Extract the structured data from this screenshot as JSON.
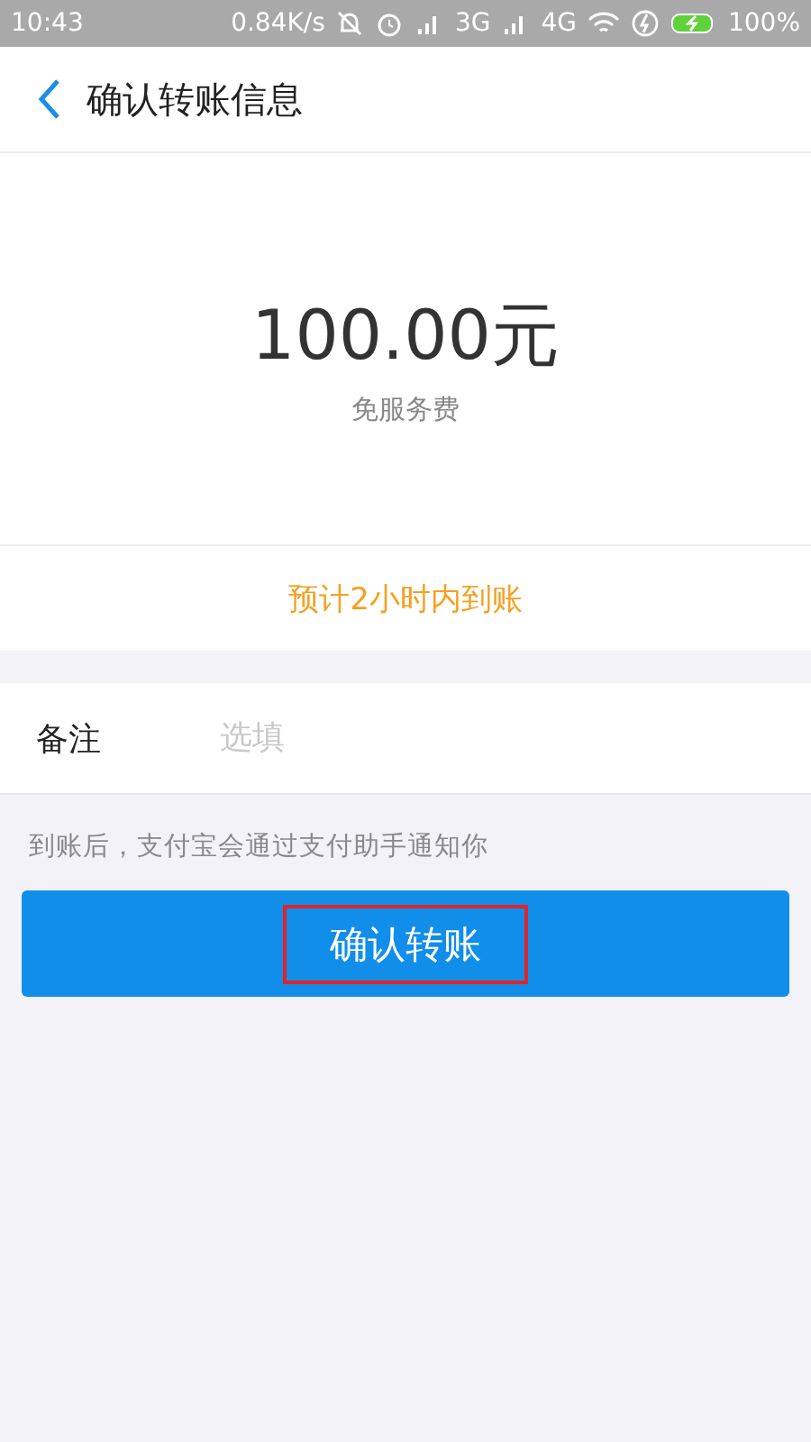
{
  "status_bar": {
    "time": "10:43",
    "speed": "0.84K/s",
    "network_1": "3G",
    "network_2": "4G",
    "battery": "100%"
  },
  "header": {
    "title": "确认转账信息"
  },
  "amount": {
    "value": "100.00元",
    "fee_note": "免服务费"
  },
  "arrival_note": "预计2小时内到账",
  "remark": {
    "label": "备注",
    "placeholder": "选填"
  },
  "notice": "到账后，支付宝会通过支付助手通知你",
  "confirm_button": {
    "label": "确认转账",
    "highlighted": true
  }
}
